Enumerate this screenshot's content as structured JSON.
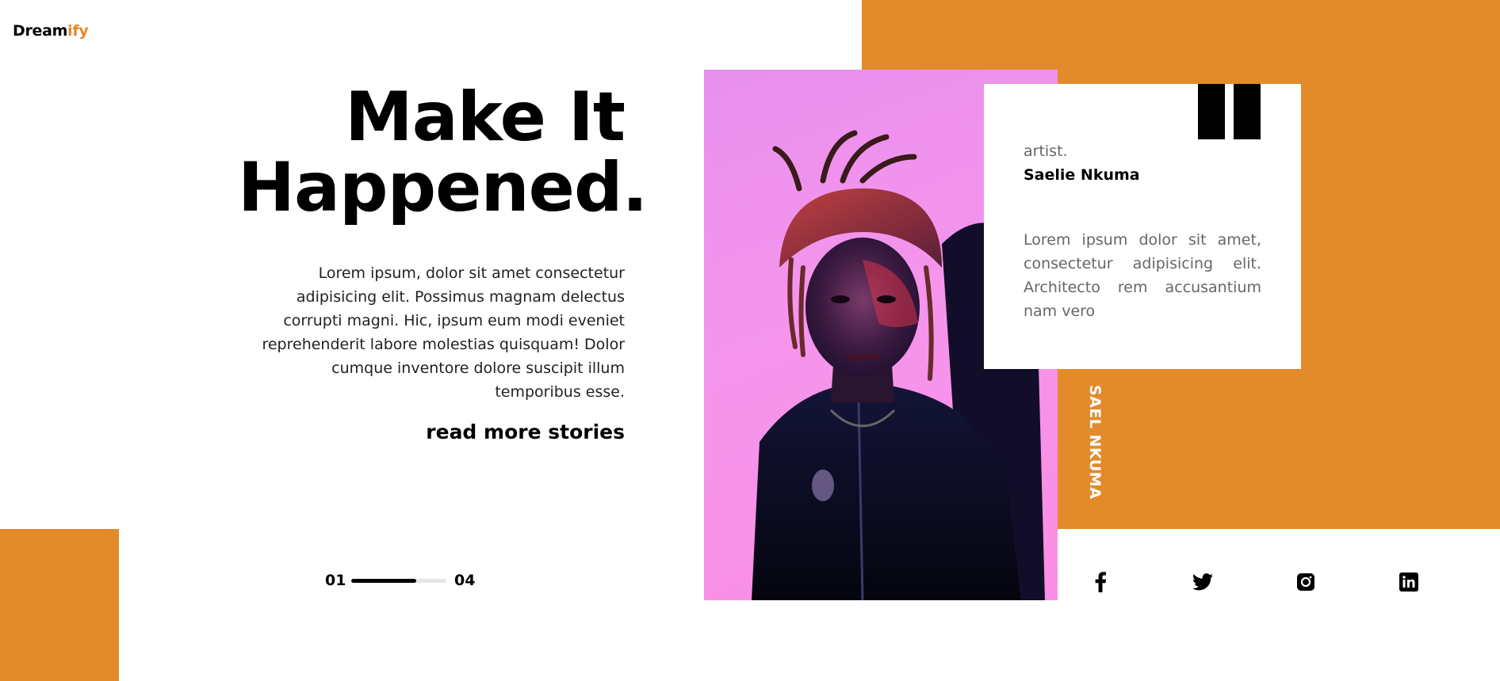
{
  "brand": {
    "name_main": "Dream",
    "name_accent": "ify",
    "accent_color": "#e38a2b"
  },
  "hero": {
    "title_line1": "Make It",
    "title_line2": "Happened.",
    "intro": "Lorem ipsum, dolor sit amet consectetur adipisicing elit. Possimus magnam delectus corrupti magni. Hic, ipsum eum modi eveniet reprehenderit labore molestias quisquam! Dolor cumque inventore dolore suscipit illum temporibus esse.",
    "cta_label": "read more stories"
  },
  "pager": {
    "current": "01",
    "total": "04",
    "progress": 0.68
  },
  "testimonial": {
    "role": "artist.",
    "name": "Saelie Nkuma",
    "text": "Lorem ipsum dolor sit amet, consectetur adipisicing elit. Architecto rem accusantium nam vero"
  },
  "vertical_label": "SAEL NKUMA",
  "social": [
    "facebook-icon",
    "twitter-icon",
    "instagram-icon",
    "linkedin-icon"
  ],
  "colors": {
    "accent": "#e38a2b",
    "photo_bg": "#f595ec"
  }
}
